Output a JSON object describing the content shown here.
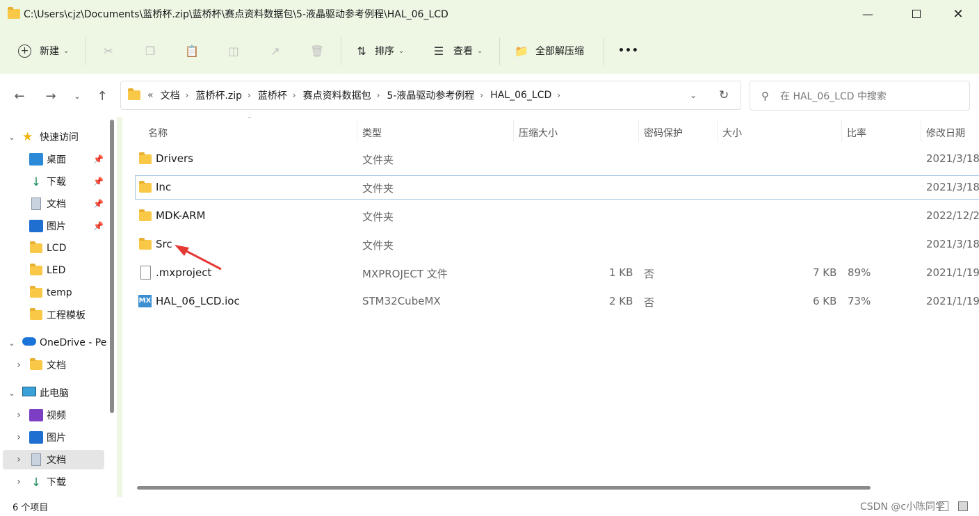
{
  "window": {
    "title_path": "C:\\Users\\cjz\\Documents\\蓝桥杯.zip\\蓝桥杯\\赛点资料数据包\\5-液晶驱动参考例程\\HAL_06_LCD"
  },
  "toolbar": {
    "new_label": "新建",
    "sort_label": "排序",
    "view_label": "查看",
    "extract_all_label": "全部解压缩",
    "more_label": "•••"
  },
  "address": {
    "crumbs": [
      "文档",
      "蓝桥杯.zip",
      "蓝桥杯",
      "赛点资料数据包",
      "5-液晶驱动参考例程",
      "HAL_06_LCD"
    ],
    "overflow": "«"
  },
  "search": {
    "placeholder": "在 HAL_06_LCD 中搜索"
  },
  "sidebar": {
    "items": [
      {
        "label": "快速访问",
        "icon": "star-icon"
      },
      {
        "label": "桌面",
        "icon": "desktop-icon"
      },
      {
        "label": "下载",
        "icon": "download-icon"
      },
      {
        "label": "文档",
        "icon": "document-icon"
      },
      {
        "label": "图片",
        "icon": "pictures-icon"
      },
      {
        "label": "LCD",
        "icon": "folder-icon"
      },
      {
        "label": "LED",
        "icon": "folder-icon"
      },
      {
        "label": "temp",
        "icon": "folder-icon"
      },
      {
        "label": "工程模板",
        "icon": "folder-icon"
      },
      {
        "label": "OneDrive - Pe",
        "icon": "cloud-icon"
      },
      {
        "label": "文档",
        "icon": "folder-icon"
      },
      {
        "label": "此电脑",
        "icon": "computer-icon"
      },
      {
        "label": "视频",
        "icon": "video-icon"
      },
      {
        "label": "图片",
        "icon": "pictures-icon"
      },
      {
        "label": "文档",
        "icon": "document-icon"
      },
      {
        "label": "下载",
        "icon": "download-icon"
      }
    ]
  },
  "columns": [
    "名称",
    "类型",
    "压缩大小",
    "密码保护",
    "大小",
    "比率",
    "修改日期"
  ],
  "files": [
    {
      "name": "Drivers",
      "type": "文件夹",
      "csize": "",
      "pw": "",
      "size": "",
      "ratio": "",
      "date": "2021/3/18",
      "icon": "folder-icon"
    },
    {
      "name": "Inc",
      "type": "文件夹",
      "csize": "",
      "pw": "",
      "size": "",
      "ratio": "",
      "date": "2021/3/18",
      "icon": "folder-icon"
    },
    {
      "name": "MDK-ARM",
      "type": "文件夹",
      "csize": "",
      "pw": "",
      "size": "",
      "ratio": "",
      "date": "2022/12/2",
      "icon": "folder-icon"
    },
    {
      "name": "Src",
      "type": "文件夹",
      "csize": "",
      "pw": "",
      "size": "",
      "ratio": "",
      "date": "2021/3/18",
      "icon": "folder-icon"
    },
    {
      "name": ".mxproject",
      "type": "MXPROJECT 文件",
      "csize": "1 KB",
      "pw": "否",
      "size": "7 KB",
      "ratio": "89%",
      "date": "2021/1/19",
      "icon": "file-icon"
    },
    {
      "name": "HAL_06_LCD.ioc",
      "type": "STM32CubeMX",
      "csize": "2 KB",
      "pw": "否",
      "size": "6 KB",
      "ratio": "73%",
      "date": "2021/1/19",
      "icon": "mx-icon"
    }
  ],
  "mx_badge": "MX",
  "status": {
    "count": "6 个项目",
    "watermark": "CSDN @c小陈同学"
  },
  "colors": {
    "chrome": "#eef6e4",
    "accent_arrow": "#e53935",
    "folder": "#f8c846"
  }
}
